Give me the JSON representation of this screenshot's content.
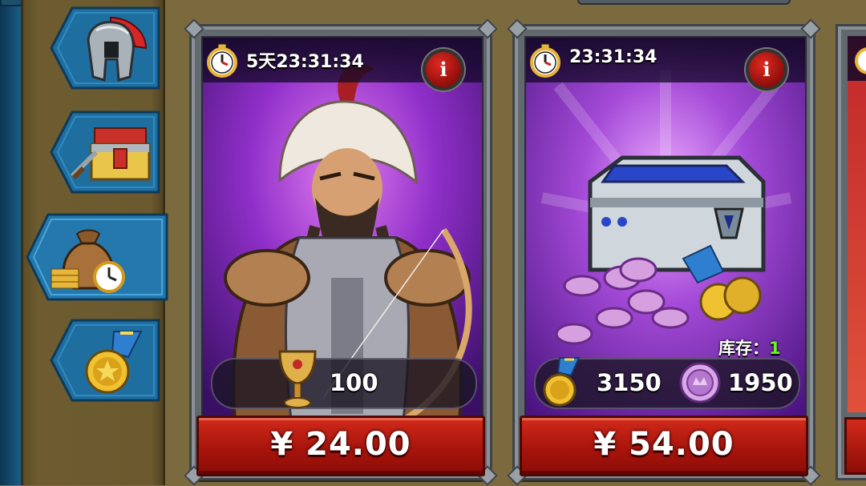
{
  "colors": {
    "panel": "#6e5c30",
    "card_frame": "#62696e",
    "price_red": "#c41f14",
    "stock_green": "#6cf02a",
    "purple_bg": "#8a34c8"
  },
  "side_tabs": [
    {
      "icon": "spartan-helmet-icon"
    },
    {
      "icon": "treasure-chest-icon"
    },
    {
      "icon": "money-bag-clock-icon"
    },
    {
      "icon": "medal-icon"
    }
  ],
  "cards": [
    {
      "timer": "5天23:31:34",
      "info": "i",
      "reward_value": "100",
      "reward_icon": "golden-chalice-icon",
      "price": "¥ 24.00",
      "art": "mongol-warrior-hero"
    },
    {
      "timer": "23:31:34",
      "info": "i",
      "stock_label": "库存：",
      "stock_value": "1",
      "reward_medal_value": "3150",
      "reward_coin_value": "1950",
      "price": "¥ 54.00",
      "art": "silver-chest-coins-medals"
    }
  ]
}
